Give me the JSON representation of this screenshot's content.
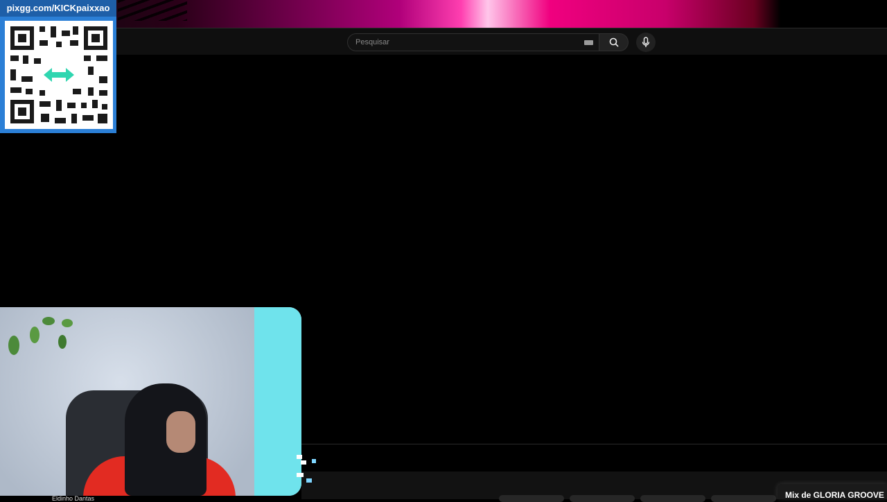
{
  "overlay": {
    "donation_url": "pixgg.com/KICKpaixxao"
  },
  "search": {
    "placeholder": "Pesquisar",
    "icons": [
      "keyboard-icon",
      "search-icon",
      "microphone-icon"
    ]
  },
  "bottom": {
    "mix_label": "Mix de GLORIA GROOVE",
    "channel_name": "Eldinho Dantas"
  },
  "colors": {
    "accent_pink": "#ff3fb0",
    "overlay_blue": "#2b7fd6",
    "background": "#000000"
  }
}
